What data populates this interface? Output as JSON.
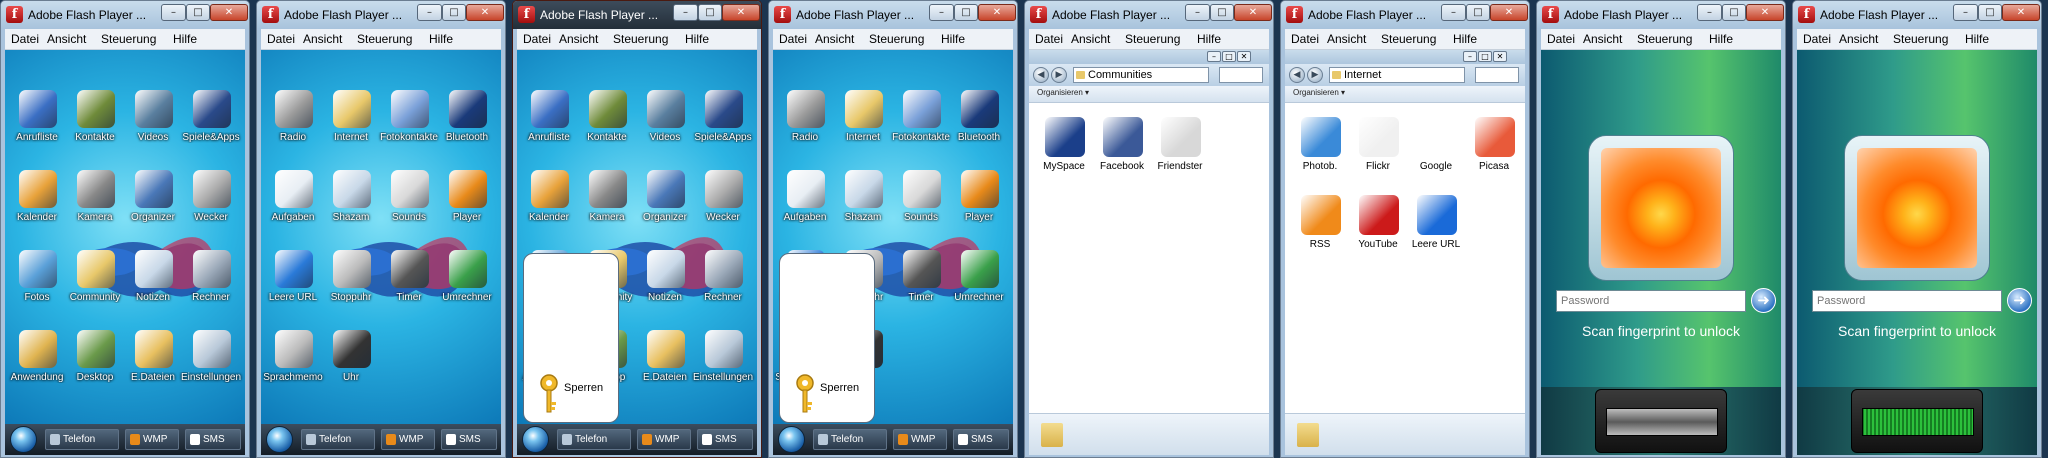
{
  "window_title": "Adobe Flash Player ...",
  "menu": [
    "Datei",
    "Ansicht",
    "Steuerung",
    "Hilfe"
  ],
  "title_buttons": {
    "minimize": "–",
    "maximize": "□",
    "close": "✕"
  },
  "taskbar": [
    "Telefon",
    "WMP",
    "SMS"
  ],
  "home_page1": [
    "Anrufliste",
    "Kontakte",
    "Videos",
    "Spiele&Apps",
    "Kalender",
    "Kamera",
    "Organizer",
    "Wecker",
    "Fotos",
    "Community",
    "Notizen",
    "Rechner",
    "Anwendung",
    "Desktop",
    "E.Dateien",
    "Einstellungen"
  ],
  "home_page2": [
    "Radio",
    "Internet",
    "Fotokontakte",
    "Bluetooth",
    "Aufgaben",
    "Shazam",
    "Sounds",
    "Player",
    "Leere URL",
    "Stoppuhr",
    "Timer",
    "Umrechner",
    "Sprachmemo",
    "Uhr"
  ],
  "lock_popup": {
    "label": "Sperren"
  },
  "explorer_communities": {
    "address": "Communities",
    "toolbar": "Organisieren ▾",
    "items": [
      "MySpace",
      "Facebook",
      "Friendster"
    ]
  },
  "explorer_internet": {
    "address": "Internet",
    "toolbar": "Organisieren ▾",
    "items": [
      "Photob.",
      "Flickr",
      "Google",
      "Picasa",
      "RSS",
      "YouTube",
      "Leere URL"
    ]
  },
  "lockscreen": {
    "password_placeholder": "Password",
    "scan_text": "Scan fingerprint to unlock"
  },
  "colors": {
    "active_titlebar": "#2f3c4a",
    "wallpaper_blue": "#2bb4e3",
    "taskbar_dark": "#1b2530",
    "fingerprint_green": "#37e24a"
  }
}
